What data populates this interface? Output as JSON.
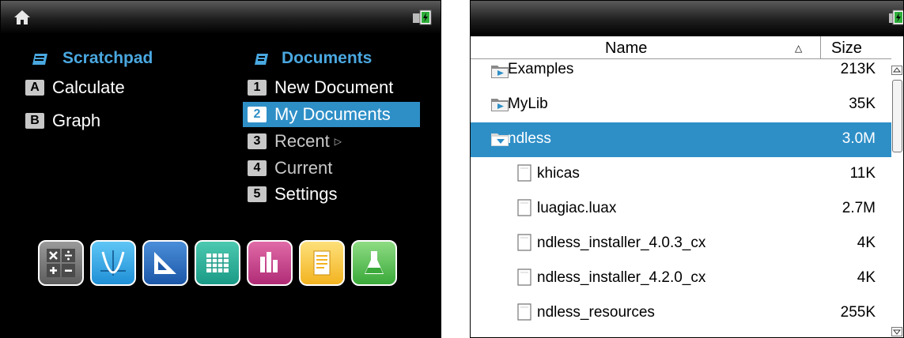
{
  "left": {
    "scratchpad": {
      "title": "Scratchpad",
      "items": [
        {
          "key": "A",
          "label": "Calculate"
        },
        {
          "key": "B",
          "label": "Graph"
        }
      ]
    },
    "documents": {
      "title": "Documents",
      "items": [
        {
          "key": "1",
          "label": "New Document"
        },
        {
          "key": "2",
          "label": "My Documents"
        },
        {
          "key": "3",
          "label": "Recent"
        },
        {
          "key": "4",
          "label": "Current"
        },
        {
          "key": "5",
          "label": "Settings"
        }
      ],
      "selected_index": 1
    },
    "apps": [
      "calculator-app-icon",
      "graphs-app-icon",
      "geometry-app-icon",
      "lists-spreadsheet-app-icon",
      "data-statistics-app-icon",
      "notes-app-icon",
      "vernier-dataquest-app-icon"
    ],
    "colors": {
      "accent": "#2e8fc7",
      "title": "#4aa8e0",
      "background": "#000000"
    }
  },
  "right": {
    "columns": {
      "name": "Name",
      "size": "Size"
    },
    "files": [
      {
        "name": "Examples",
        "size": "213K",
        "type": "folder"
      },
      {
        "name": "MyLib",
        "size": "35K",
        "type": "folder"
      },
      {
        "name": "ndless",
        "size": "3.0M",
        "type": "folder-open"
      },
      {
        "name": "khicas",
        "size": "11K",
        "type": "file"
      },
      {
        "name": "luagiac.luax",
        "size": "2.7M",
        "type": "file"
      },
      {
        "name": "ndless_installer_4.0.3_cx",
        "size": "4K",
        "type": "file"
      },
      {
        "name": "ndless_installer_4.2.0_cx",
        "size": "4K",
        "type": "file"
      },
      {
        "name": "ndless_resources",
        "size": "255K",
        "type": "file"
      }
    ],
    "selected_index": 2
  }
}
